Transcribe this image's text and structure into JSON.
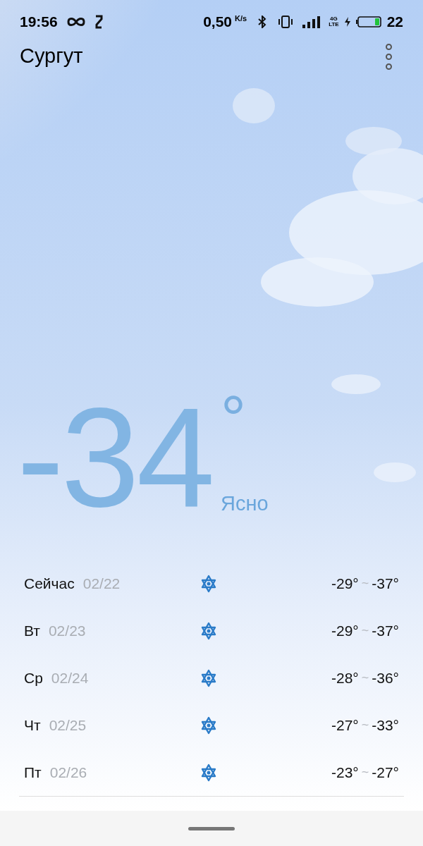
{
  "status_bar": {
    "time": "19:56",
    "net_speed": "0,50",
    "speed_unit": "K/s",
    "network_top": "4G",
    "network_bottom": "LTE",
    "battery_percent": "22"
  },
  "header": {
    "city": "Сургут"
  },
  "current": {
    "temperature": "-34",
    "degree": "°",
    "condition": "Ясно"
  },
  "forecast": [
    {
      "day": "Сейчас",
      "date": "02/22",
      "high": "-29°",
      "separator": "~",
      "low": "-37°"
    },
    {
      "day": "Вт",
      "date": "02/23",
      "high": "-29°",
      "separator": "~",
      "low": "-37°"
    },
    {
      "day": "Ср",
      "date": "02/24",
      "high": "-28°",
      "separator": "~",
      "low": "-36°"
    },
    {
      "day": "Чт",
      "date": "02/25",
      "high": "-27°",
      "separator": "~",
      "low": "-33°"
    },
    {
      "day": "Пт",
      "date": "02/26",
      "high": "-23°",
      "separator": "~",
      "low": "-27°"
    }
  ]
}
